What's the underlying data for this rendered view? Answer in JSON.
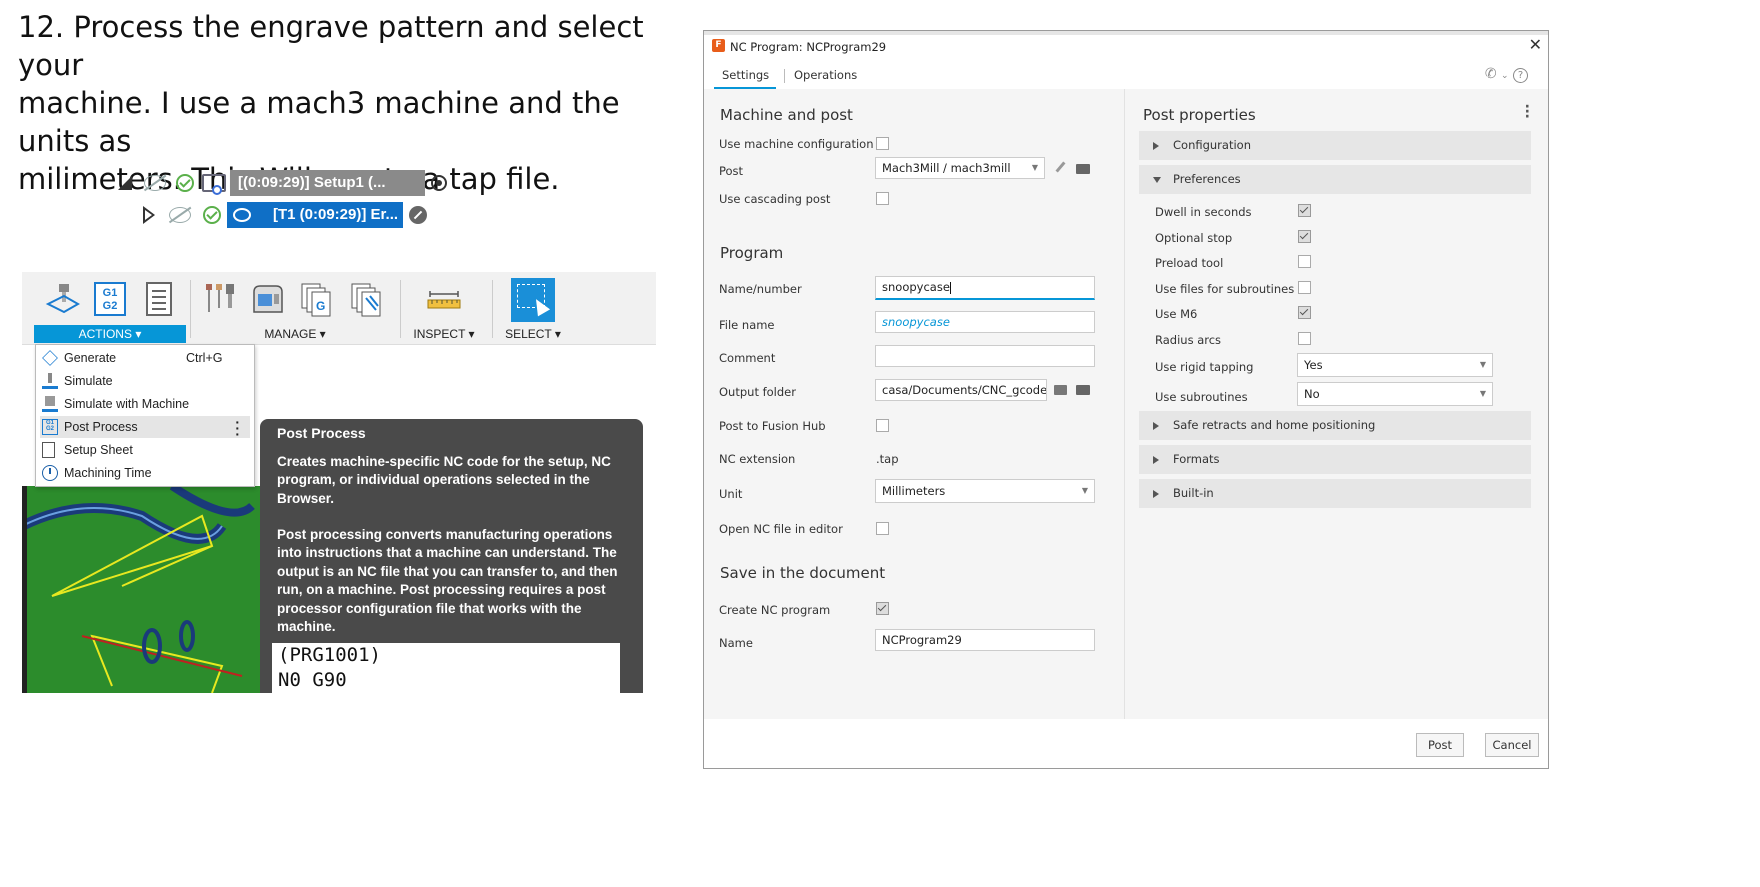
{
  "caption": {
    "line1": "12. Process the engrave pattern and select your",
    "line2": "machine. I use a mach3 machine and the units as",
    "line3": "milimeters. This Will create a tap file."
  },
  "browser_tree": [
    {
      "label": "[(0:09:29)] Setup1 (..."
    },
    {
      "label": "[T1 (0:09:29)] Er..."
    }
  ],
  "toolbar": {
    "groups": [
      {
        "label": "ACTIONS ▾"
      },
      {
        "label": "MANAGE ▾"
      },
      {
        "label": "INSPECT ▾"
      },
      {
        "label": "SELECT ▾"
      }
    ],
    "g1g2_icon_text": "G1\nG2",
    "g_icon_text": "G"
  },
  "actions_menu": [
    {
      "label": "Generate",
      "shortcut": "Ctrl+G",
      "icon": "generate-icon"
    },
    {
      "label": "Simulate",
      "shortcut": "",
      "icon": "simulate-icon"
    },
    {
      "label": "Simulate with Machine",
      "shortcut": "",
      "icon": "simulate-machine-icon"
    },
    {
      "label": "Post Process",
      "shortcut": "",
      "icon": "post-process-icon",
      "selected": true
    },
    {
      "label": "Setup Sheet",
      "shortcut": "",
      "icon": "setup-sheet-icon"
    },
    {
      "label": "Machining Time",
      "shortcut": "",
      "icon": "clock-icon"
    }
  ],
  "tooltip": {
    "title": "Post Process",
    "p1": "Creates machine-specific NC code for the setup, NC program, or individual operations selected in the Browser.",
    "p2": "Post processing converts manufacturing operations into instructions that a machine can understand. The output is an NC file that you can transfer to, and then run, on a machine. Post processing requires a post processor configuration file that works with the machine.",
    "code_line1": "(PRG1001)",
    "code_line2": "N0 G90"
  },
  "dialog": {
    "title": "NC Program: NCProgram29",
    "tabs": [
      "Settings",
      "Operations"
    ],
    "machine_and_post": {
      "heading": "Machine and post",
      "use_machine_configuration": {
        "label": "Use machine configuration",
        "checked": false
      },
      "post": {
        "label": "Post",
        "value": "Mach3Mill / mach3mill"
      },
      "use_cascading_post": {
        "label": "Use cascading post",
        "checked": false
      }
    },
    "program": {
      "heading": "Program",
      "name_number": {
        "label": "Name/number",
        "value": "snoopycase"
      },
      "file_name": {
        "label": "File name",
        "value": "snoopycase"
      },
      "comment": {
        "label": "Comment",
        "value": ""
      },
      "output_folder": {
        "label": "Output folder",
        "value": "casa/Documents/CNC_gcode"
      },
      "post_to_fusion_hub": {
        "label": "Post to Fusion Hub",
        "checked": false
      },
      "nc_extension": {
        "label": "NC extension",
        "value": ".tap"
      },
      "unit": {
        "label": "Unit",
        "value": "Millimeters"
      },
      "open_nc_file": {
        "label": "Open NC file in editor",
        "checked": false
      }
    },
    "save": {
      "heading": "Save in the document",
      "create_nc_program": {
        "label": "Create NC program",
        "checked": true
      },
      "name": {
        "label": "Name",
        "value": "NCProgram29"
      }
    },
    "post_properties": {
      "heading": "Post properties",
      "configuration": "Configuration",
      "preferences": "Preferences",
      "items": [
        {
          "label": "Dwell in seconds",
          "checked": true
        },
        {
          "label": "Optional stop",
          "checked": true
        },
        {
          "label": "Preload tool",
          "checked": false
        },
        {
          "label": "Use files for subroutines",
          "checked": false
        },
        {
          "label": "Use M6",
          "checked": true
        },
        {
          "label": "Radius arcs",
          "checked": false
        }
      ],
      "use_rigid_tapping": {
        "label": "Use rigid tapping",
        "value": "Yes"
      },
      "use_subroutines": {
        "label": "Use subroutines",
        "value": "No"
      },
      "safe_retracts": "Safe retracts and home positioning",
      "formats": "Formats",
      "built_in": "Built-in"
    },
    "buttons": {
      "post": "Post",
      "cancel": "Cancel"
    }
  },
  "colors": {
    "accent": "#0696d7",
    "tooltip_bg": "#4a4a4a",
    "viewport_green": "#2c8c2c",
    "tree_selected": "#0f6fc6",
    "tree_setup_bg": "#8a8a8a"
  }
}
